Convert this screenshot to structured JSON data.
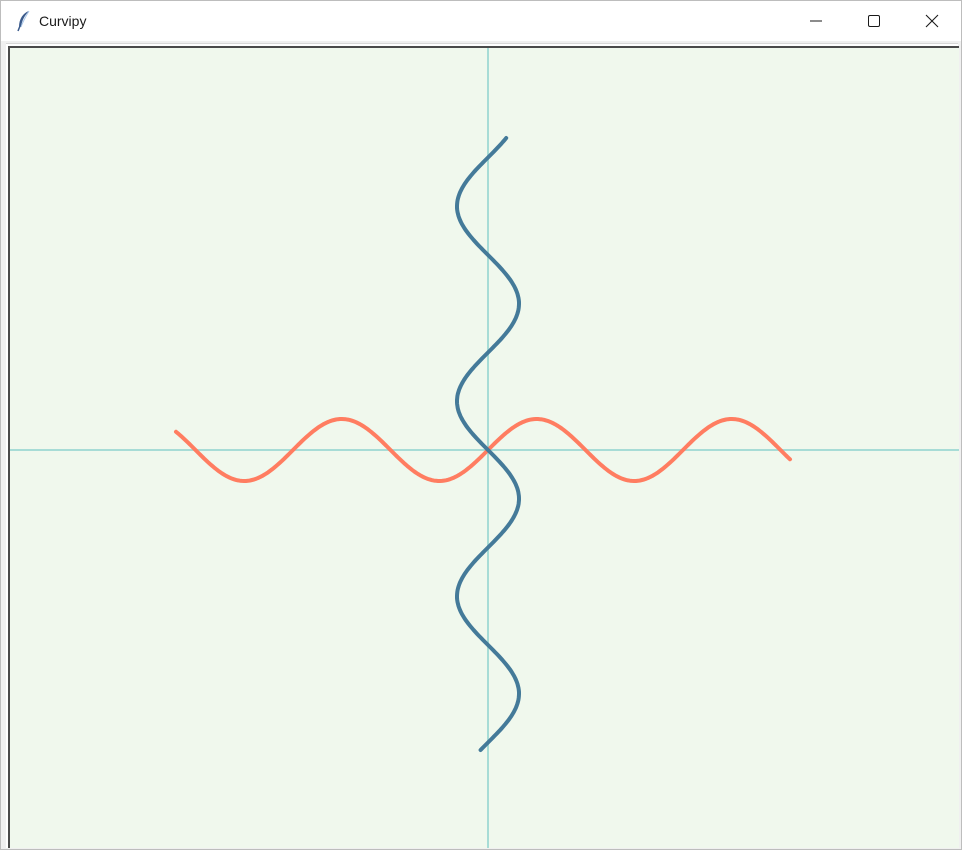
{
  "window": {
    "title": "Curvipy",
    "icon": "feather-icon",
    "controls": [
      "minimize-icon",
      "maximize-icon",
      "close-icon"
    ]
  },
  "canvas": {
    "background": "#f0f8ed",
    "axis_color": "#a7dcd6"
  },
  "curves": [
    {
      "name": "horizontal-sine",
      "color": "#ff7d61",
      "stroke": 4,
      "orientation": "horizontal"
    },
    {
      "name": "vertical-sine",
      "color": "#447a99",
      "stroke": 4,
      "orientation": "vertical"
    }
  ]
}
